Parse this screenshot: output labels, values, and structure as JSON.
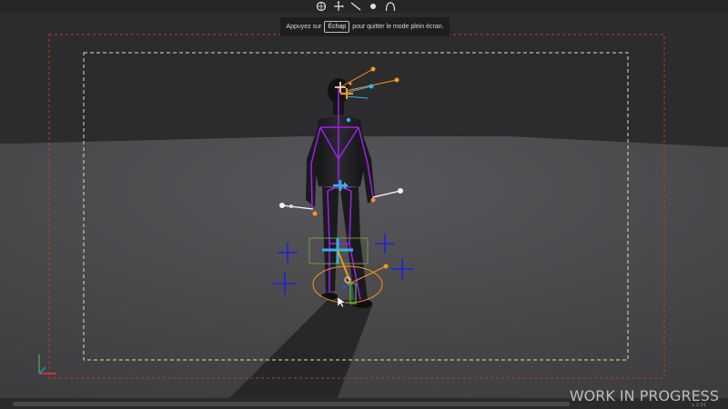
{
  "notice": {
    "before": "Appuyez sur",
    "key": "Échap",
    "after": "pour quitter le mode plein écran."
  },
  "toolbar": {
    "tools": [
      "rotate-tool-icon",
      "move-tool-icon",
      "bone-tool-icon",
      "point-tool-icon",
      "curve-tool-icon"
    ]
  },
  "watermark": {
    "text": "WORK IN PROGRESS",
    "small": "x 2:01"
  },
  "colors": {
    "background": "#2c2b2d",
    "floor": "#49484a",
    "skeleton": "#a020f0",
    "handle_orange": "#f5951e",
    "handle_cyan": "#33b5e5",
    "effector_blue": "#2020e0",
    "safe_frame_red": "#c0392b",
    "safe_frame_yellow": "#e8dcb0",
    "axis_x": "#e53935",
    "axis_y": "#43a047",
    "axis_z": "#1e88e5"
  }
}
